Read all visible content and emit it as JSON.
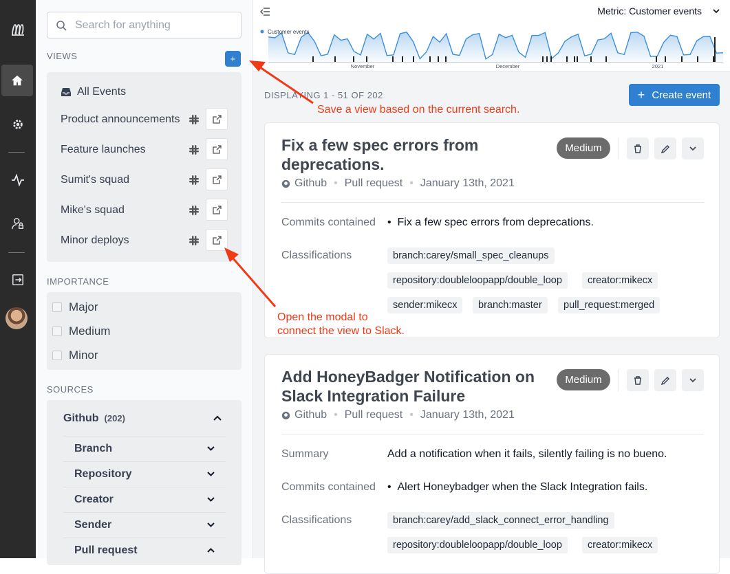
{
  "rail": {
    "items": [
      "logo-icon",
      "home-icon",
      "gear-icon",
      "activity-icon",
      "user-lock-icon",
      "logout-icon",
      "avatar"
    ]
  },
  "search": {
    "placeholder": "Search for anything"
  },
  "views": {
    "heading": "VIEWS",
    "add_label": "+",
    "all_events": "All Events",
    "items": [
      {
        "label": "Product announcements"
      },
      {
        "label": "Feature launches"
      },
      {
        "label": "Sumit's squad"
      },
      {
        "label": "Mike's squad"
      },
      {
        "label": "Minor deploys"
      }
    ]
  },
  "importance": {
    "heading": "IMPORTANCE",
    "options": [
      "Major",
      "Medium",
      "Minor"
    ]
  },
  "sources": {
    "heading": "SOURCES",
    "github_label": "Github",
    "github_count": "(202)",
    "filters": [
      "Branch",
      "Repository",
      "Creator",
      "Sender",
      "Pull request"
    ]
  },
  "topbar": {
    "metric_label": "Metric: Customer events",
    "legend": "Customer events",
    "months": [
      "November",
      "December",
      "2021"
    ]
  },
  "chart_data": {
    "type": "area",
    "series": [
      {
        "name": "Customer events"
      }
    ],
    "x_tick_labels": [
      "November",
      "December",
      "2021"
    ],
    "grid": false,
    "legend": "top-left"
  },
  "list": {
    "displaying": "DISPLAYING 1 - 51 OF 202",
    "create_label": "Create event",
    "create_plus": "+"
  },
  "events": [
    {
      "title": "Fix a few spec errors from deprecations.",
      "importance": "Medium",
      "source": "Github",
      "type": "Pull request",
      "date": "January 13th, 2021",
      "commits_label": "Commits contained",
      "commits": "Fix a few spec errors from deprecations.",
      "class_label": "Classifications",
      "tags": [
        "branch:carey/small_spec_cleanups",
        "repository:doubleloopapp/double_loop",
        "creator:mikecx",
        "sender:mikecx",
        "branch:master",
        "pull_request:merged"
      ]
    },
    {
      "title": "Add HoneyBadger Notification on Slack Integration Failure",
      "importance": "Medium",
      "source": "Github",
      "type": "Pull request",
      "date": "January 13th, 2021",
      "summary_label": "Summary",
      "summary": "Add a notification when it fails, silently failing is no bueno.",
      "commits_label": "Commits contained",
      "commits": "Alert Honeybadger when the Slack Integration fails.",
      "class_label": "Classifications",
      "tags": [
        "branch:carey/add_slack_connect_error_handling",
        "repository:doubleloopapp/double_loop",
        "creator:mikecx"
      ]
    }
  ],
  "annotations": {
    "save_view": "Save a view based on the current search.",
    "slack_line1": "Open the modal to",
    "slack_line2": "connect the view to Slack."
  },
  "colors": {
    "accent": "#2f80d1",
    "annotation": "#f03a17",
    "rail": "#2b2b2b"
  }
}
